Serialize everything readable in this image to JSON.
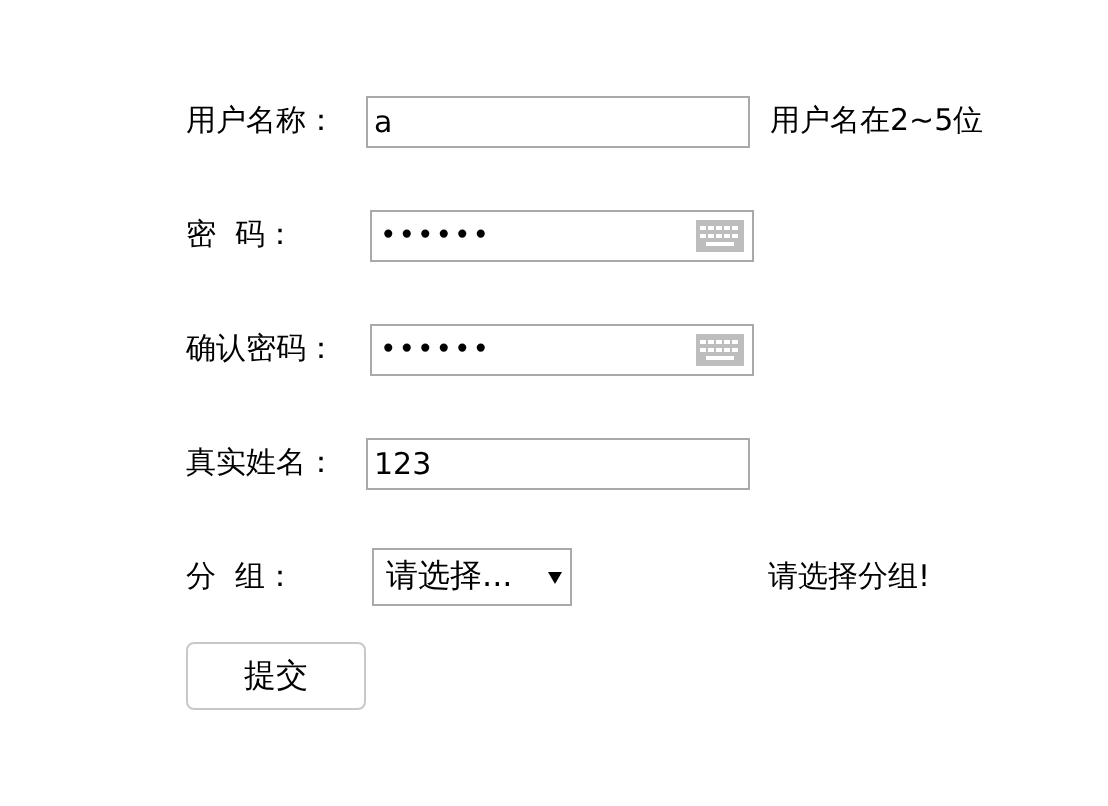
{
  "fields": [
    {
      "kind": "text",
      "label": "用户名称：",
      "value": "a",
      "hint": "用户名在2~5位"
    },
    {
      "kind": "password",
      "label": "密  码：",
      "value": "••••••"
    },
    {
      "kind": "password",
      "label": "确认密码：",
      "value": "••••••"
    },
    {
      "kind": "text",
      "label": "真实姓名：",
      "value": "123"
    },
    {
      "kind": "select",
      "label": "分  组：",
      "value": "请选择...",
      "hint": "请选择分组!"
    }
  ],
  "submit": "提交"
}
